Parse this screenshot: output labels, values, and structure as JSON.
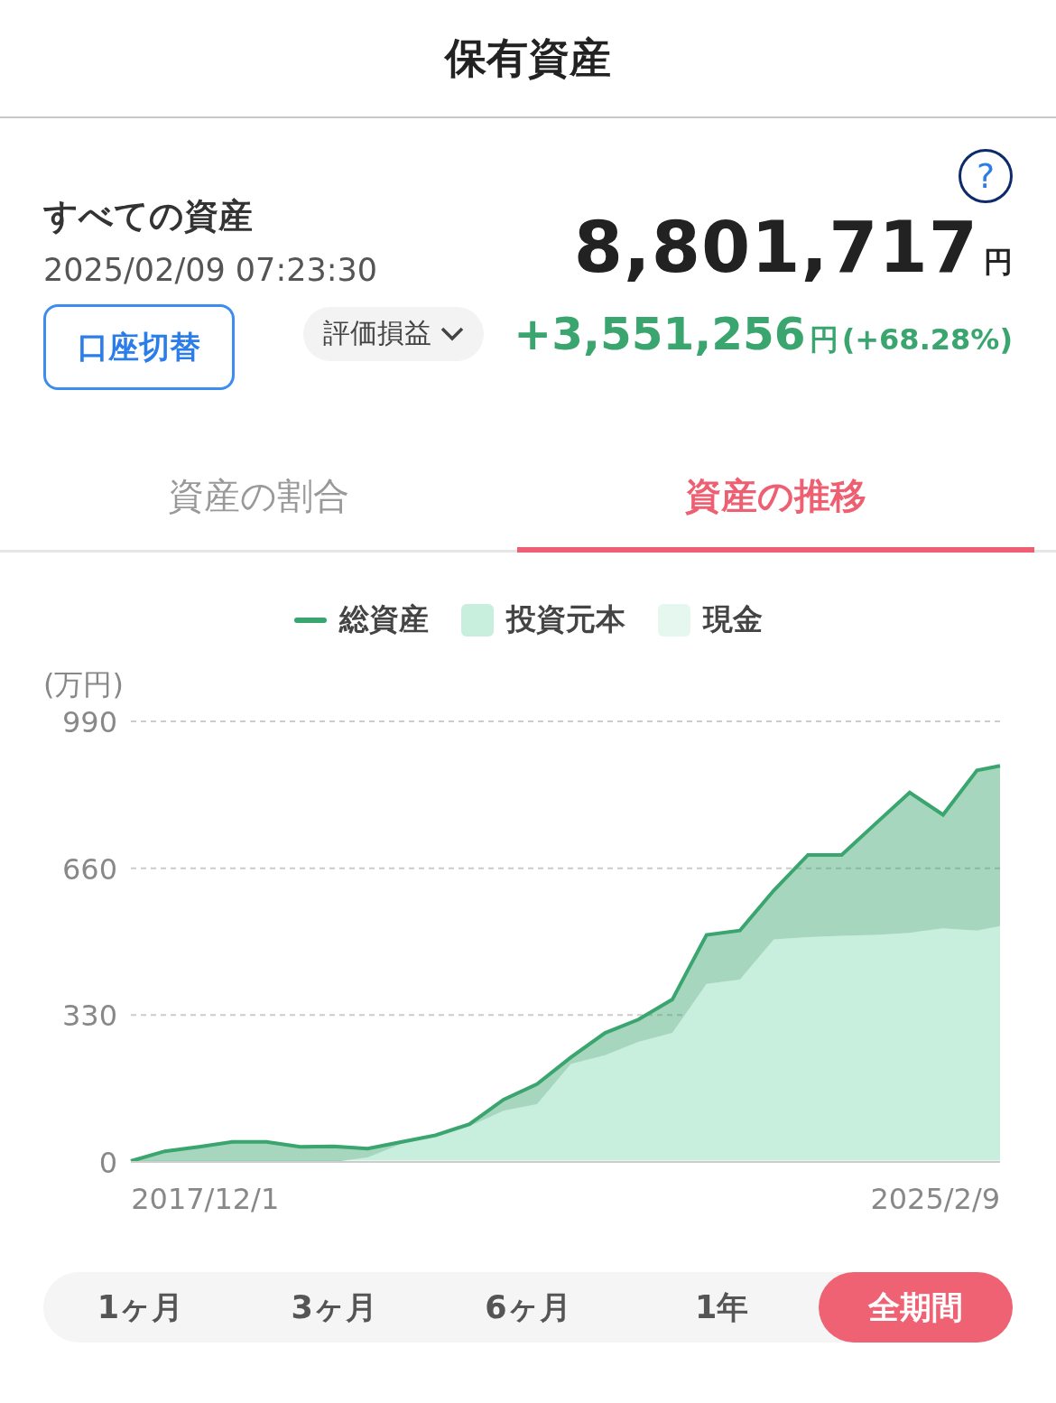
{
  "header": {
    "title": "保有資産"
  },
  "summary": {
    "title": "すべての資産",
    "timestamp": "2025/02/09 07:23:30",
    "help": "?",
    "amount": "8,801,717",
    "amount_unit": "円",
    "switch_button": "口座切替",
    "dropdown": "評価損益",
    "gain": "+3,551,256",
    "gain_unit": "円",
    "gain_rate": "(+68.28%)"
  },
  "tabs": [
    {
      "label": "資産の割合",
      "selected": false
    },
    {
      "label": "資産の推移",
      "selected": true
    }
  ],
  "chart_data": {
    "type": "area",
    "ylabel": "(万円)",
    "yticks": [
      0,
      330,
      660,
      990
    ],
    "ylim": [
      0,
      990
    ],
    "x": [
      "2017-03-09",
      "2017-07-09",
      "2017-11-09",
      "2018-03-09",
      "2018-07-09",
      "2018-11-09",
      "2019-03-09",
      "2019-07-09",
      "2019-11-09",
      "2020-03-09",
      "2020-07-09",
      "2020-11-09",
      "2021-03-09",
      "2021-07-09",
      "2021-11-09",
      "2022-03-09",
      "2022-07-09",
      "2022-11-09",
      "2023-03-09",
      "2023-07-09",
      "2023-11-09",
      "2024-03-09",
      "2024-07-09",
      "2024-11-09",
      "2025-03-09",
      "2025-07-09",
      "2025-09-30"
    ],
    "xlim": [
      "2017-03-09",
      "2025-09-30"
    ],
    "xticks": [
      {
        "value": "2017-12-01",
        "label": "2017/12/1"
      },
      {
        "value": "2025-02-09",
        "label": "2025/2/9"
      }
    ],
    "series": [
      {
        "name": "総資産",
        "color": "#3aa56e",
        "values": [
          2,
          24,
          34,
          45,
          45,
          34,
          35,
          30,
          45,
          60,
          85,
          140,
          175,
          235,
          290,
          320,
          365,
          510,
          520,
          610,
          690,
          690,
          760,
          830,
          780,
          880,
          890
        ]
      },
      {
        "name": "投資元本",
        "color": "#c8eedd",
        "values": [
          0,
          0,
          0,
          0,
          0,
          0,
          0,
          10,
          41,
          55,
          80,
          115,
          130,
          220,
          240,
          270,
          290,
          400,
          410,
          500,
          505,
          508,
          510,
          515,
          525,
          520,
          530
        ]
      },
      {
        "name": "現金",
        "color": "#e6f7ef",
        "values": [
          4,
          4,
          4,
          4,
          4,
          4,
          4,
          4,
          4,
          4,
          4,
          4,
          4,
          4,
          4,
          4,
          4,
          4,
          4,
          4,
          4,
          4,
          4,
          4,
          4,
          4,
          4
        ]
      }
    ]
  },
  "periods": [
    {
      "label": "1ヶ月",
      "selected": false
    },
    {
      "label": "3ヶ月",
      "selected": false
    },
    {
      "label": "6ヶ月",
      "selected": false
    },
    {
      "label": "1年",
      "selected": false
    },
    {
      "label": "全期間",
      "selected": true
    }
  ]
}
